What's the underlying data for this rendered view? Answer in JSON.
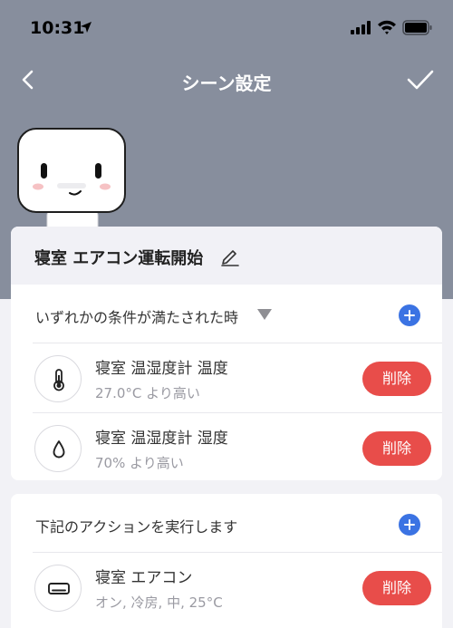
{
  "status_bar": {
    "time": "10:31"
  },
  "nav": {
    "title": "シーン設定"
  },
  "scene": {
    "name": "寝室 エアコン運転開始"
  },
  "conditions": {
    "label": "いずれかの条件が満たされた時",
    "items": [
      {
        "icon": "thermometer-icon",
        "title": "寝室 温湿度計 温度",
        "detail": "27.0°C より高い",
        "delete_label": "削除"
      },
      {
        "icon": "water-drop-icon",
        "title": "寝室 温湿度計 湿度",
        "detail": "70% より高い",
        "delete_label": "削除"
      }
    ]
  },
  "actions": {
    "label": "下記のアクションを実行します",
    "items": [
      {
        "icon": "air-conditioner-icon",
        "title": "寝室 エアコン",
        "detail": "オン, 冷房, 中, 25°C",
        "delete_label": "削除"
      }
    ]
  },
  "colors": {
    "header_bg": "#878e9d",
    "accent_blue": "#3b73e3",
    "delete_red": "#e84d4a"
  }
}
